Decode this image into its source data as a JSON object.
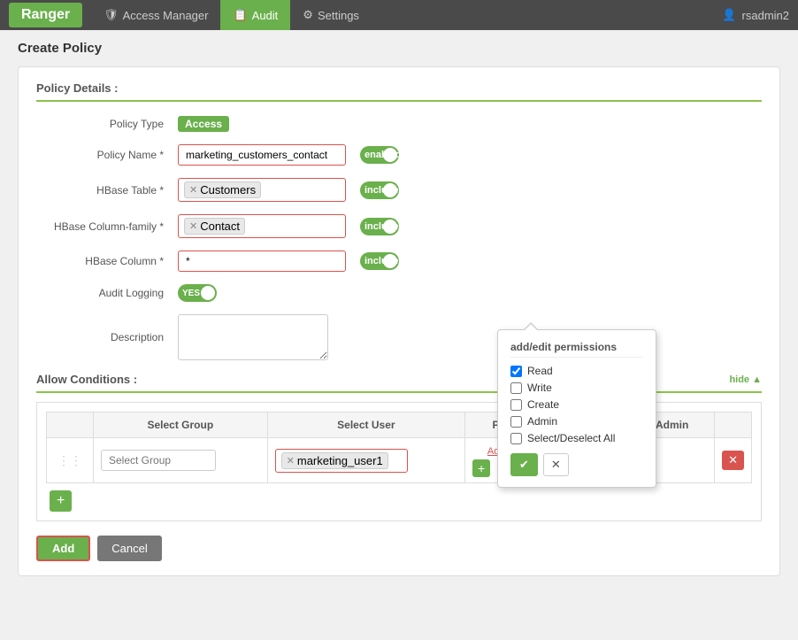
{
  "navbar": {
    "brand": "Ranger",
    "items": [
      {
        "id": "access-manager",
        "label": "Access Manager",
        "icon": "🛡",
        "active": false
      },
      {
        "id": "audit",
        "label": "Audit",
        "icon": "📋",
        "active": true
      },
      {
        "id": "settings",
        "label": "Settings",
        "icon": "⚙",
        "active": false
      }
    ],
    "user": "rsadmin2",
    "user_icon": "👤"
  },
  "page": {
    "title": "Create Policy"
  },
  "policy_details": {
    "section_title": "Policy Details :",
    "policy_type_label": "Policy Type",
    "policy_type_badge": "Access",
    "policy_name_label": "Policy Name *",
    "policy_name_value": "marketing_customers_contact",
    "policy_name_toggle": "enabled",
    "hbase_table_label": "HBase Table *",
    "hbase_table_tag": "Customers",
    "hbase_table_toggle": "include",
    "hbase_cf_label": "HBase Column-family *",
    "hbase_cf_tag": "Contact",
    "hbase_cf_toggle": "include",
    "hbase_col_label": "HBase Column *",
    "hbase_col_value": "*",
    "hbase_col_toggle": "include",
    "audit_label": "Audit Logging",
    "audit_value": "YES",
    "desc_label": "Description",
    "desc_placeholder": ""
  },
  "allow_conditions": {
    "section_title": "Allow Conditions :",
    "hide_link": "hide ▲",
    "table": {
      "col_select_group": "Select Group",
      "col_select_user": "Select User",
      "col_permissions": "Permissions",
      "col_delegate": "Delegate Admin",
      "row": {
        "select_group_placeholder": "Select Group",
        "select_user_tag": "marketing_user1",
        "add_permissions_label": "Add Permissions",
        "add_btn": "+"
      }
    },
    "add_row_btn": "+"
  },
  "popup": {
    "title": "add/edit permissions",
    "items": [
      {
        "id": "read",
        "label": "Read",
        "checked": true
      },
      {
        "id": "write",
        "label": "Write",
        "checked": false
      },
      {
        "id": "create",
        "label": "Create",
        "checked": false
      },
      {
        "id": "admin",
        "label": "Admin",
        "checked": false
      },
      {
        "id": "select-deselect-all",
        "label": "Select/Deselect All",
        "checked": false
      }
    ],
    "ok_btn": "✔",
    "cancel_btn": "✕"
  },
  "footer": {
    "add_btn": "Add",
    "cancel_btn": "Cancel"
  }
}
